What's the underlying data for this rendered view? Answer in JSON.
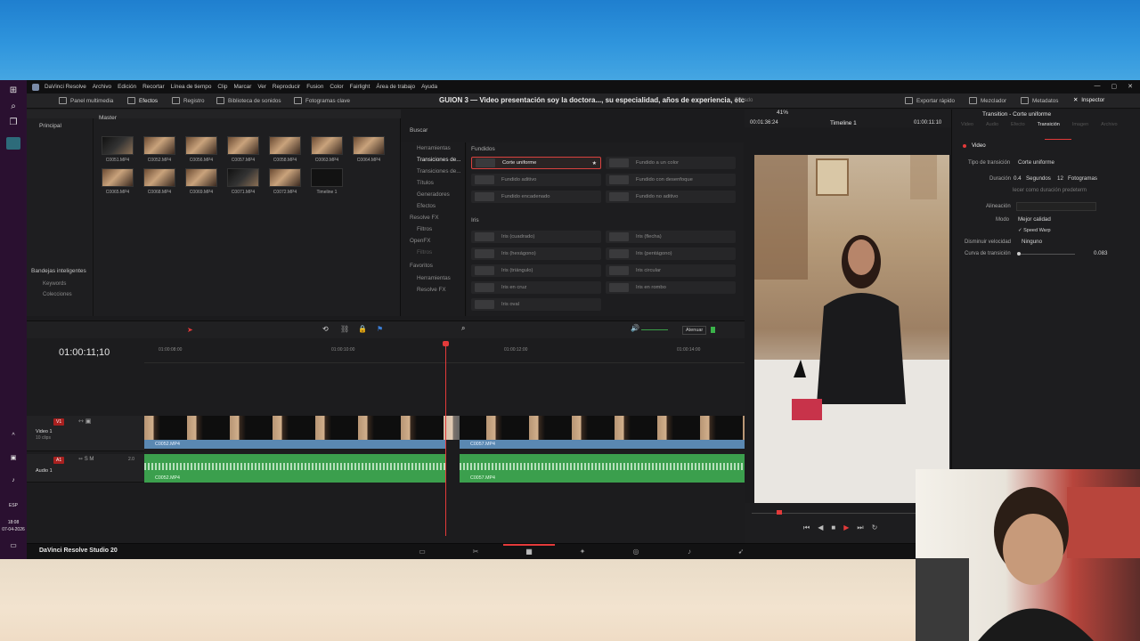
{
  "app": {
    "menu": [
      "DaVinci Resolve",
      "Archivo",
      "Edición",
      "Recortar",
      "Línea de tiempo",
      "Clip",
      "Marcar",
      "Ver",
      "Reproducir",
      "Fusion",
      "Color",
      "Fairlight",
      "Área de trabajo",
      "Ayuda"
    ],
    "toolbar": {
      "media_pool": "Panel multimedia",
      "effects": "Efectos",
      "edit_index": "Registro",
      "sound_library": "Biblioteca de sonidos",
      "keyframes": "Fotogramas clave",
      "project_title": "GUION 3 — Video presentación soy la doctora..., su especialidad, años de experiencia, etc",
      "edited": "Editado",
      "quick_export": "Exportar rápido",
      "mixer": "Mezclador",
      "metadata": "Metadatos",
      "inspector": "Inspector"
    }
  },
  "media_pool": {
    "principal": "Principal",
    "master": "Master",
    "smart_bins": "Bandejas inteligentes",
    "keywords": "Keywords",
    "collections": "Colecciones",
    "clips": [
      "C0051.MP4",
      "C0052.MP4",
      "C0056.MP4",
      "C0057.MP4",
      "C0058.MP4",
      "C0063.MP4",
      "C0064.MP4",
      "C0065.MP4",
      "C0068.MP4",
      "C0069.MP4",
      "C0071.MP4",
      "C0072.MP4",
      "Timeline 1"
    ]
  },
  "effects": {
    "search": "Buscar",
    "tree": [
      "Herramientas",
      "Transiciones de...",
      "Transiciones de...",
      "Títulos",
      "Generadores",
      "Efectos",
      "Resolve FX",
      "Filtros",
      "OpenFX",
      "Filtros",
      "Favoritos",
      "Herramientas",
      "Resolve FX"
    ],
    "group_dissolve": "Fundidos",
    "dissolves": [
      "Corte uniforme",
      "Fundido a un color",
      "Fundido aditivo",
      "Fundido con desenfoque",
      "Fundido encadenado",
      "Fundido no aditivo"
    ],
    "group_iris": "Iris",
    "iris": [
      "Iris (cuadrado)",
      "Iris (flecha)",
      "Iris (hexágono)",
      "Iris (pentágono)",
      "Iris (triángulo)",
      "Iris circular",
      "Iris en cruz",
      "Iris en rombo",
      "Iris oval"
    ]
  },
  "viewer": {
    "zoom": "41%",
    "timecode_left": "00:01:36:24",
    "timeline_name": "Timeline 1",
    "timecode_right": "01:00:11:10"
  },
  "inspector": {
    "title": "Transition - Corte uniforme",
    "tabs": [
      "Video",
      "Audio",
      "Efecto",
      "Transición",
      "Imagen",
      "Archivo"
    ],
    "section": "Video",
    "transition_type_label": "Tipo de transición",
    "transition_type_value": "Corte uniforme",
    "duration_label": "Duración",
    "duration_seconds": "0.4",
    "seconds_word": "Segundos",
    "duration_frames": "12",
    "frames_word": "Fotogramas",
    "set_default": "lecer como duración predeterm",
    "alignment_label": "Alineación",
    "mode_label": "Modo",
    "mode_value": "Mejor calidad",
    "speed_warp": "Speed Warp",
    "ease_label": "Disminuir velocidad",
    "ease_value": "Ninguno",
    "curve_label": "Curva de transición",
    "curve_value": "0.083"
  },
  "timeline": {
    "timecode": "01:00:11;10",
    "ruler": [
      "01:00:08:00",
      "01:00:10:00",
      "01:00:12:00",
      "01:00:14:00"
    ],
    "attenuate": "Atenuar",
    "video_track": {
      "badge": "V1",
      "name": "Video 1",
      "sub": "10 clips"
    },
    "audio_track": {
      "badge": "A1",
      "name": "Audio 1",
      "level": "2.0"
    },
    "clip_a": "C0052.MP4",
    "clip_b": "C0057.MP4"
  },
  "pagebar": {
    "brand": "DaVinci Resolve Studio 20"
  },
  "taskbar": {
    "lang": "ESP",
    "time": "18:08",
    "date": "07-04-2026"
  },
  "colors": {
    "accent_red": "#e33a3a",
    "video_clip": "#5a88b2",
    "audio_clip": "#3b9f4d"
  }
}
